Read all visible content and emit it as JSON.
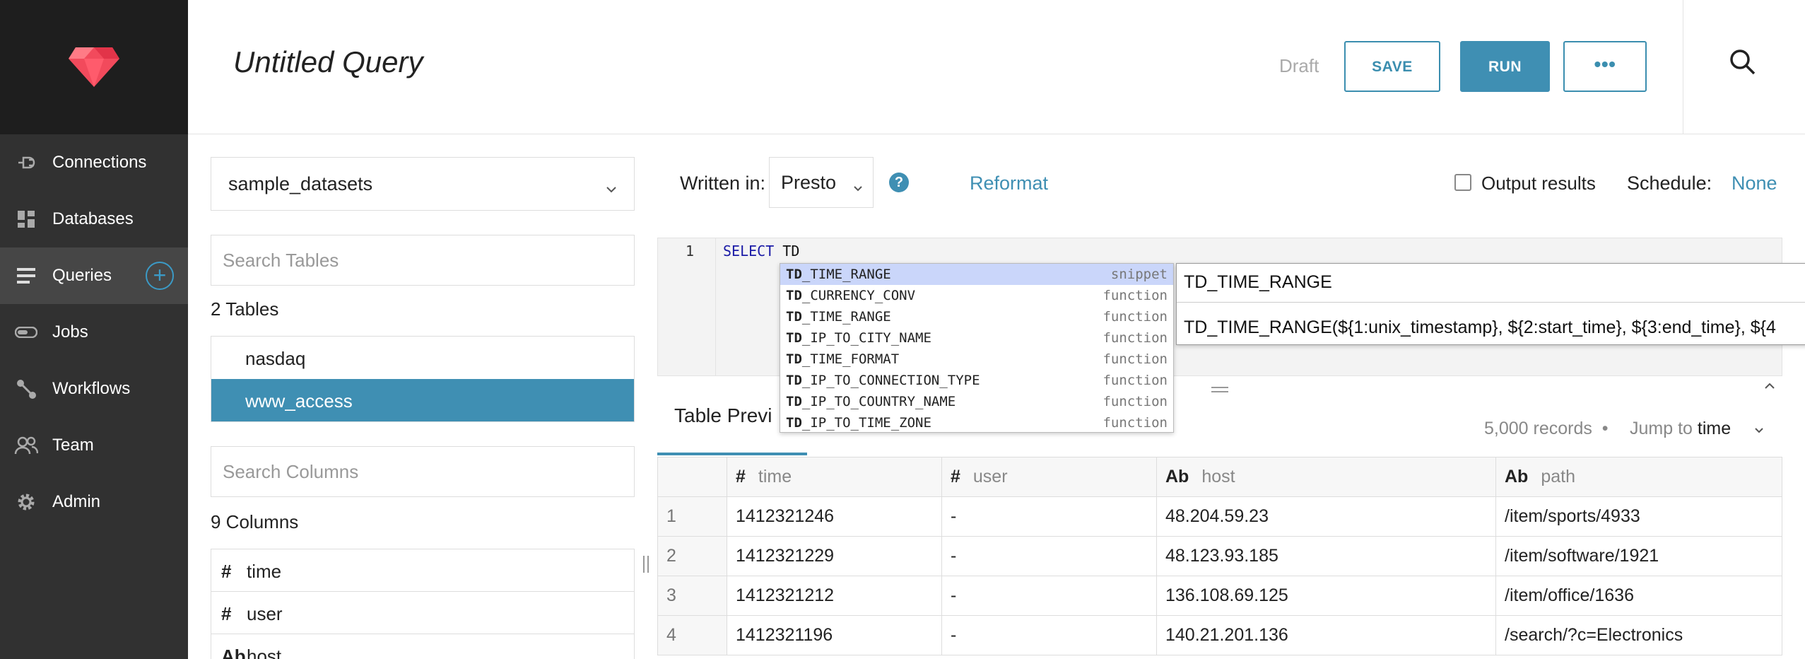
{
  "sidebar": {
    "items": [
      {
        "label": "Connections",
        "icon": "connection-plug-icon"
      },
      {
        "label": "Databases",
        "icon": "grid-icon"
      },
      {
        "label": "Queries",
        "icon": "list-icon"
      },
      {
        "label": "Jobs",
        "icon": "toggle-icon"
      },
      {
        "label": "Workflows",
        "icon": "workflow-icon"
      },
      {
        "label": "Team",
        "icon": "people-icon"
      },
      {
        "label": "Admin",
        "icon": "gear-icon"
      }
    ],
    "add_label": "+"
  },
  "header": {
    "title": "Untitled Query",
    "draft": "Draft",
    "save_label": "SAVE",
    "run_label": "RUN",
    "more_label": "•••"
  },
  "left": {
    "database": "sample_datasets",
    "search_tables_placeholder": "Search Tables",
    "tables_count": "2 Tables",
    "tables": [
      "nasdaq",
      "www_access"
    ],
    "search_columns_placeholder": "Search Columns",
    "columns_count": "9 Columns",
    "columns": [
      {
        "type": "#",
        "name": "time"
      },
      {
        "type": "#",
        "name": "user"
      },
      {
        "type": "Ab",
        "name": "host"
      }
    ]
  },
  "toolbar": {
    "written_in": "Written in:",
    "engine": "Presto",
    "help": "?",
    "reformat": "Reformat",
    "output_results": "Output results",
    "schedule_label": "Schedule:",
    "schedule_value": "None"
  },
  "editor": {
    "line_number": "1",
    "keyword": "SELECT",
    "text": " TD"
  },
  "autocomplete": [
    {
      "prefix": "TD",
      "rest": "_TIME_RANGE",
      "meta": "snippet"
    },
    {
      "prefix": "TD",
      "rest": "_CURRENCY_CONV",
      "meta": "function"
    },
    {
      "prefix": "TD",
      "rest": "_TIME_RANGE",
      "meta": "function"
    },
    {
      "prefix": "TD",
      "rest": "_IP_TO_CITY_NAME",
      "meta": "function"
    },
    {
      "prefix": "TD",
      "rest": "_TIME_FORMAT",
      "meta": "function"
    },
    {
      "prefix": "TD",
      "rest": "_IP_TO_CONNECTION_TYPE",
      "meta": "function"
    },
    {
      "prefix": "TD",
      "rest": "_IP_TO_COUNTRY_NAME",
      "meta": "function"
    },
    {
      "prefix": "TD",
      "rest": "_IP_TO_TIME_ZONE",
      "meta": "function"
    }
  ],
  "doc": {
    "title": "TD_TIME_RANGE",
    "signature": "TD_TIME_RANGE(${1:unix_timestamp}, ${2:start_time}, ${3:end_time}, ${4"
  },
  "results": {
    "tab": "Table Previ",
    "records": "5,000 records",
    "bullet": "•",
    "jump_label": "Jump to",
    "jump_value": "time",
    "columns": [
      {
        "type": "#",
        "name": "time"
      },
      {
        "type": "#",
        "name": "user"
      },
      {
        "type": "Ab",
        "name": "host"
      },
      {
        "type": "Ab",
        "name": "path"
      }
    ],
    "rows": [
      [
        "1",
        "1412321246",
        "-",
        "48.204.59.23",
        "/item/sports/4933"
      ],
      [
        "2",
        "1412321229",
        "-",
        "48.123.93.185",
        "/item/software/1921"
      ],
      [
        "3",
        "1412321212",
        "-",
        "136.108.69.125",
        "/item/office/1636"
      ],
      [
        "4",
        "1412321196",
        "-",
        "140.21.201.136",
        "/search/?c=Electronics"
      ]
    ]
  },
  "colors": {
    "accent": "#3f8fb3",
    "sidebar": "#313131",
    "logo_bg": "#1e1e1e",
    "autocomplete_highlight": "#cad6fa"
  }
}
